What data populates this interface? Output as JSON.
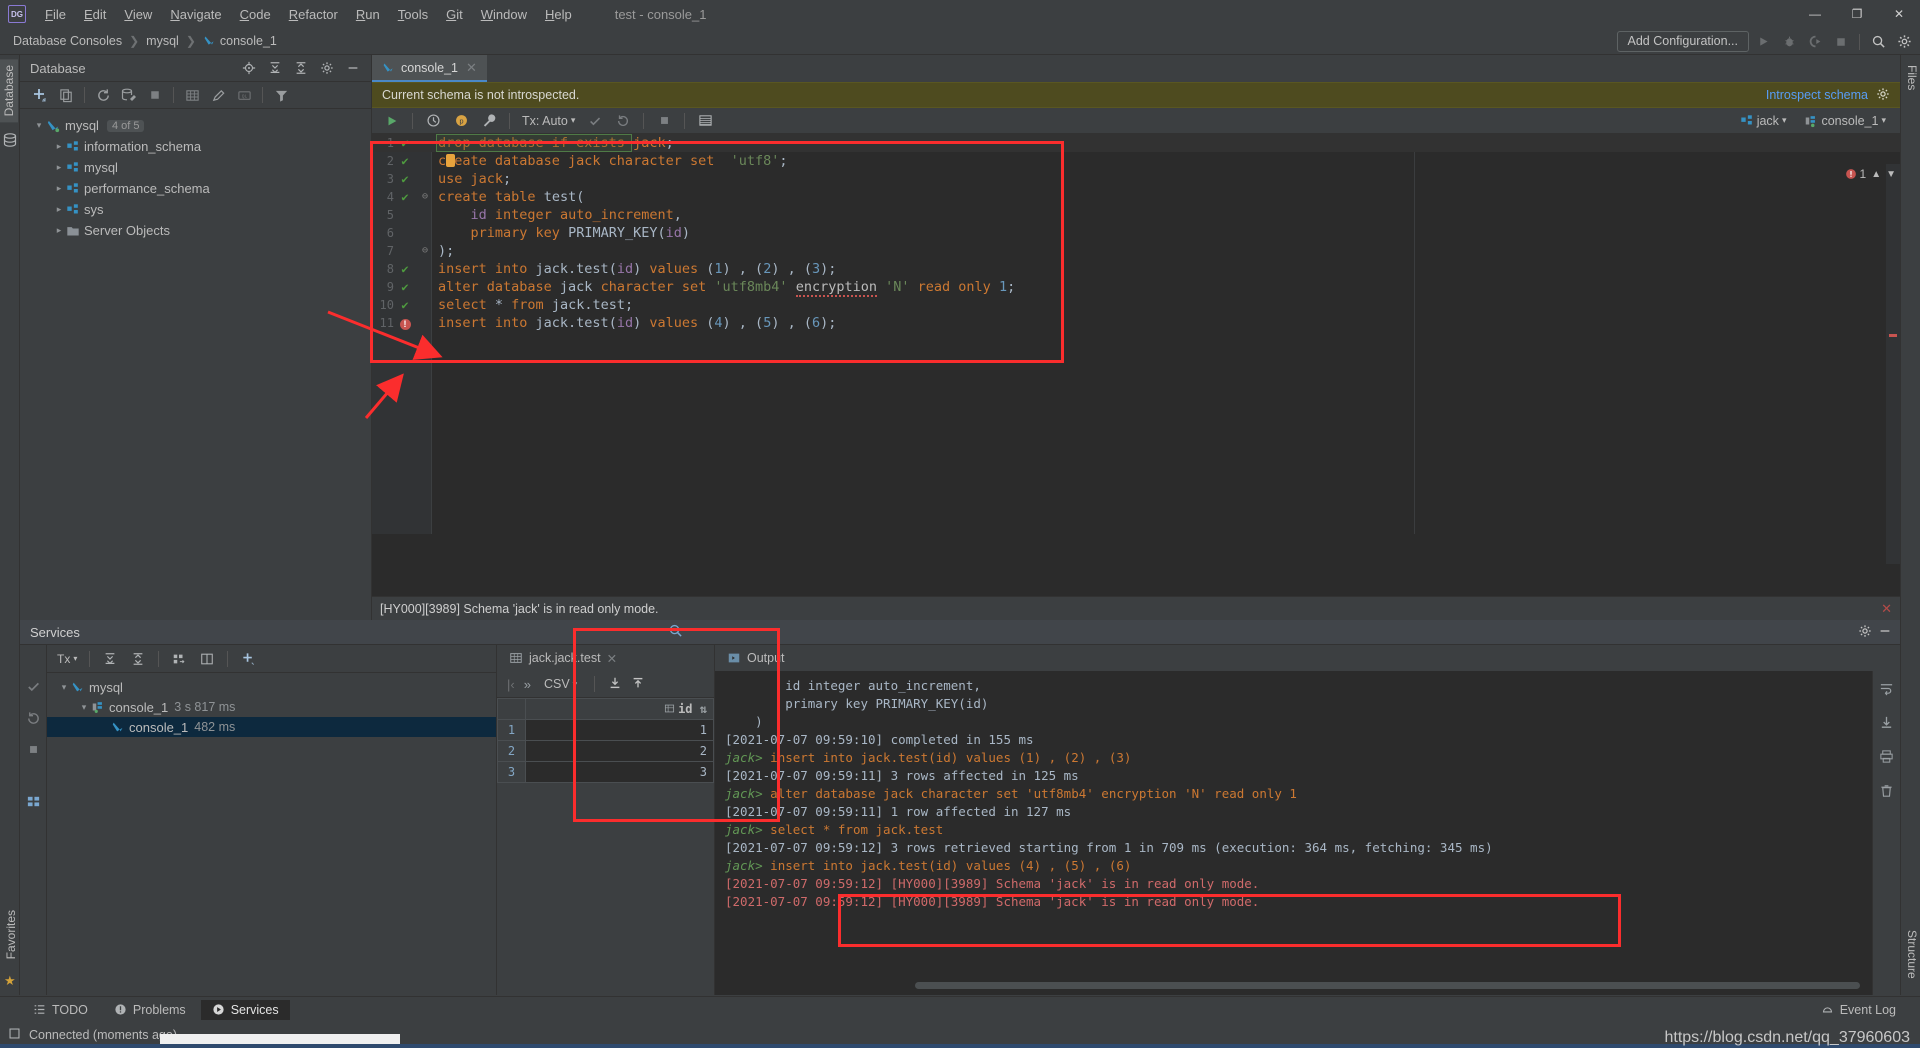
{
  "window": {
    "title": "test - console_1",
    "logo": "DG"
  },
  "menubar": {
    "items": [
      "File",
      "Edit",
      "View",
      "Navigate",
      "Code",
      "Refactor",
      "Run",
      "Tools",
      "Git",
      "Window",
      "Help"
    ]
  },
  "window_controls": {
    "minimize": "—",
    "maximize": "❐",
    "close": "✕"
  },
  "breadcrumb": {
    "items": [
      "Database Consoles",
      "mysql",
      "console_1"
    ],
    "separator": "❯"
  },
  "top_right_toolbar": {
    "add_configuration": "Add Configuration...",
    "icons": [
      "run-icon",
      "debug-icon",
      "run-with-coverage-icon",
      "stop-icon",
      "search-everywhere-icon",
      "settings-icon"
    ]
  },
  "left_strips": {
    "database_tab": "Database",
    "favorites_tab": "Favorites"
  },
  "right_strips": {
    "files_tab": "Files",
    "structure_tab": "Structure"
  },
  "database_panel": {
    "title": "Database",
    "toolbar_icons": [
      "add-icon",
      "copy-icon",
      "refresh-icon",
      "db-tools-icon",
      "stop-icon",
      "table-icon",
      "edit-icon",
      "query-console-icon",
      "filter-icon"
    ],
    "header_icons": [
      "locate-icon",
      "expand-all-icon",
      "collapse-all-icon",
      "settings-icon",
      "hide-icon"
    ],
    "tree": [
      {
        "label": "mysql",
        "badge": "4 of 5",
        "icon": "datasource-icon",
        "expanded": true,
        "depth": 0
      },
      {
        "label": "information_schema",
        "badge": "",
        "icon": "schema-icon",
        "expanded": false,
        "depth": 1
      },
      {
        "label": "mysql",
        "badge": "",
        "icon": "schema-icon",
        "expanded": false,
        "depth": 1
      },
      {
        "label": "performance_schema",
        "badge": "",
        "icon": "schema-icon",
        "expanded": false,
        "depth": 1
      },
      {
        "label": "sys",
        "badge": "",
        "icon": "schema-icon",
        "expanded": false,
        "depth": 1
      },
      {
        "label": "Server Objects",
        "badge": "",
        "icon": "folder-icon",
        "expanded": false,
        "depth": 1
      }
    ]
  },
  "editor": {
    "tab_label": "console_1",
    "notification": {
      "message": "Current schema is not introspected.",
      "action": "Introspect schema"
    },
    "toolbar": {
      "tx_mode": "Tx: Auto",
      "icons": [
        "execute-icon",
        "history-icon",
        "parameters-icon",
        "wrench-icon",
        "commit-icon",
        "rollback-icon",
        "stop-icon",
        "output-icon"
      ]
    },
    "session": {
      "schema": "jack",
      "console": "console_1"
    },
    "inspection": {
      "error_count": "1"
    },
    "error_bar": "[HY000][3989] Schema 'jack' is in read only mode.",
    "lines": [
      {
        "n": "1",
        "mark": "ok",
        "fold": "",
        "cursor": true,
        "tokens": [
          {
            "t": "drop database if exists jack",
            "c": "k"
          },
          {
            "t": ";",
            "c": "pn"
          }
        ]
      },
      {
        "n": "2",
        "mark": "ok",
        "fold": "",
        "tokens": [
          {
            "t": "create database jack character set",
            "c": "k"
          },
          {
            "t": "  ",
            "c": "pn"
          },
          {
            "t": "'utf8'",
            "c": "str"
          },
          {
            "t": ";",
            "c": "pn"
          }
        ]
      },
      {
        "n": "3",
        "mark": "ok",
        "fold": "",
        "tokens": [
          {
            "t": "use jack",
            "c": "k"
          },
          {
            "t": ";",
            "c": "pn"
          }
        ]
      },
      {
        "n": "4",
        "mark": "ok",
        "fold": "open",
        "tokens": [
          {
            "t": "create table",
            "c": "k"
          },
          {
            "t": " ",
            "c": "pn"
          },
          {
            "t": "test",
            "c": "id2"
          },
          {
            "t": "(",
            "c": "pn"
          }
        ]
      },
      {
        "n": "5",
        "mark": "",
        "fold": "",
        "tokens": [
          {
            "t": "    ",
            "c": "pn"
          },
          {
            "t": "id",
            "c": "col"
          },
          {
            "t": " ",
            "c": "pn"
          },
          {
            "t": "integer auto_increment",
            "c": "k"
          },
          {
            "t": ",",
            "c": "pn"
          }
        ]
      },
      {
        "n": "6",
        "mark": "",
        "fold": "",
        "tokens": [
          {
            "t": "    ",
            "c": "pn"
          },
          {
            "t": "primary key",
            "c": "k"
          },
          {
            "t": " ",
            "c": "pn"
          },
          {
            "t": "PRIMARY_KEY",
            "c": "id2"
          },
          {
            "t": "(",
            "c": "pn"
          },
          {
            "t": "id",
            "c": "col"
          },
          {
            "t": ")",
            "c": "pn"
          }
        ]
      },
      {
        "n": "7",
        "mark": "",
        "fold": "close",
        "tokens": [
          {
            "t": ");",
            "c": "pn"
          }
        ]
      },
      {
        "n": "8",
        "mark": "ok",
        "fold": "",
        "tokens": [
          {
            "t": "insert into",
            "c": "k"
          },
          {
            "t": " jack.test",
            "c": "id2"
          },
          {
            "t": "(",
            "c": "pn"
          },
          {
            "t": "id",
            "c": "col"
          },
          {
            "t": ") ",
            "c": "pn"
          },
          {
            "t": "values",
            "c": "k"
          },
          {
            "t": " (",
            "c": "pn"
          },
          {
            "t": "1",
            "c": "num"
          },
          {
            "t": ") , (",
            "c": "pn"
          },
          {
            "t": "2",
            "c": "num"
          },
          {
            "t": ") , (",
            "c": "pn"
          },
          {
            "t": "3",
            "c": "num"
          },
          {
            "t": ");",
            "c": "pn"
          }
        ]
      },
      {
        "n": "9",
        "mark": "ok",
        "fold": "",
        "tokens": [
          {
            "t": "alter database",
            "c": "k"
          },
          {
            "t": " jack ",
            "c": "id2"
          },
          {
            "t": "character set",
            "c": "k"
          },
          {
            "t": " ",
            "c": "pn"
          },
          {
            "t": "'utf8mb4'",
            "c": "str"
          },
          {
            "t": " ",
            "c": "pn"
          },
          {
            "t": "encryption",
            "c": "squig"
          },
          {
            "t": " ",
            "c": "pn"
          },
          {
            "t": "'N'",
            "c": "str"
          },
          {
            "t": " ",
            "c": "pn"
          },
          {
            "t": "read only",
            "c": "k"
          },
          {
            "t": " ",
            "c": "pn"
          },
          {
            "t": "1",
            "c": "num"
          },
          {
            "t": ";",
            "c": "pn"
          }
        ]
      },
      {
        "n": "10",
        "mark": "ok",
        "fold": "",
        "tokens": [
          {
            "t": "select",
            "c": "k"
          },
          {
            "t": " * ",
            "c": "pn"
          },
          {
            "t": "from",
            "c": "k"
          },
          {
            "t": " jack.test",
            "c": "id2"
          },
          {
            "t": ";",
            "c": "pn"
          }
        ]
      },
      {
        "n": "11",
        "mark": "error",
        "fold": "",
        "tokens": [
          {
            "t": "insert into",
            "c": "k"
          },
          {
            "t": " jack.test",
            "c": "id2"
          },
          {
            "t": "(",
            "c": "pn"
          },
          {
            "t": "id",
            "c": "col"
          },
          {
            "t": ") ",
            "c": "pn"
          },
          {
            "t": "values",
            "c": "k"
          },
          {
            "t": " (",
            "c": "pn"
          },
          {
            "t": "4",
            "c": "num"
          },
          {
            "t": ") , (",
            "c": "pn"
          },
          {
            "t": "5",
            "c": "num"
          },
          {
            "t": ") , (",
            "c": "pn"
          },
          {
            "t": "6",
            "c": "num"
          },
          {
            "t": ");",
            "c": "pn"
          }
        ]
      }
    ]
  },
  "services": {
    "title": "Services",
    "toolbar_icons": [
      "tx-icon",
      "expand-all-icon",
      "collapse-all-icon",
      "group-icon",
      "layout-icon",
      "add-icon"
    ],
    "rail_icons": [
      "commit-icon",
      "rollback-icon",
      "stop-icon",
      "grid-icon"
    ],
    "tree": [
      {
        "label": "mysql",
        "time": "",
        "icon": "datasource-icon",
        "depth": 0,
        "expanded": true,
        "selected": false
      },
      {
        "label": "console_1",
        "time": "3 s 817 ms",
        "icon": "session-icon",
        "depth": 1,
        "expanded": true,
        "selected": false
      },
      {
        "label": "console_1",
        "time": "482 ms",
        "icon": "query-icon",
        "depth": 2,
        "expanded": false,
        "selected": true
      }
    ]
  },
  "result_grid": {
    "tab_label": "jack.jack.test",
    "toolbar": {
      "first_page": "|‹",
      "next": "»",
      "format": "CSV",
      "icons": [
        "download-icon",
        "upload-icon",
        "transpose-icon",
        "view-icon",
        "settings-icon"
      ]
    },
    "columns": [
      "id"
    ],
    "rows": [
      {
        "num": "1",
        "id": "1"
      },
      {
        "num": "2",
        "id": "2"
      },
      {
        "num": "3",
        "id": "3"
      }
    ]
  },
  "output": {
    "tab_label": "Output",
    "rail_icons": [
      "wrap-icon",
      "scroll-end-icon",
      "print-icon",
      "delete-icon"
    ],
    "lines": [
      {
        "kind": "gray",
        "text": "        id integer auto_increment,"
      },
      {
        "kind": "gray",
        "text": "        primary key PRIMARY_KEY(id)"
      },
      {
        "kind": "gray",
        "text": "    )"
      },
      {
        "kind": "gray",
        "text": "[2021-07-07 09:59:10] completed in 155 ms"
      },
      {
        "kind": "sql",
        "prompt": "jack>",
        "text": " insert into jack.test(id) values (1) , (2) , (3)"
      },
      {
        "kind": "gray",
        "text": "[2021-07-07 09:59:11] 3 rows affected in 125 ms"
      },
      {
        "kind": "sql",
        "prompt": "jack>",
        "text": " alter database jack character set 'utf8mb4' encryption 'N' read only 1"
      },
      {
        "kind": "gray",
        "text": "[2021-07-07 09:59:11] 1 row affected in 127 ms"
      },
      {
        "kind": "sql",
        "prompt": "jack>",
        "text": " select * from jack.test"
      },
      {
        "kind": "gray",
        "text": "[2021-07-07 09:59:12] 3 rows retrieved starting from 1 in 709 ms (execution: 364 ms, fetching: 345 ms)"
      },
      {
        "kind": "sql",
        "prompt": "jack>",
        "text": " insert into jack.test(id) values (4) , (5) , (6)"
      },
      {
        "kind": "error",
        "text": "[2021-07-07 09:59:12] [HY000][3989] Schema 'jack' is in read only mode."
      },
      {
        "kind": "error",
        "text": "[2021-07-07 09:59:12] [HY000][3989] Schema 'jack' is in read only mode."
      }
    ]
  },
  "bottom_tabs": [
    {
      "label": "TODO",
      "icon": "todo-icon",
      "active": false
    },
    {
      "label": "Problems",
      "icon": "problems-icon",
      "active": false
    },
    {
      "label": "Services",
      "icon": "services-icon",
      "active": true
    }
  ],
  "event_log": "Event Log",
  "status": {
    "text": "Connected (moments ago)",
    "icon": "connection-icon"
  },
  "watermark": "https://blog.csdn.net/qq_37960603",
  "colors": {
    "accent_blue": "#4a88c7",
    "link_blue": "#589df6",
    "warn_bg": "#4e4b1f",
    "error_red": "#cf6a6a",
    "annotation_red": "#fb2d2d",
    "ok_green": "#4e9a3f",
    "keyword_orange": "#cc7832",
    "string_green": "#6a8759",
    "number_blue": "#6897bb"
  }
}
